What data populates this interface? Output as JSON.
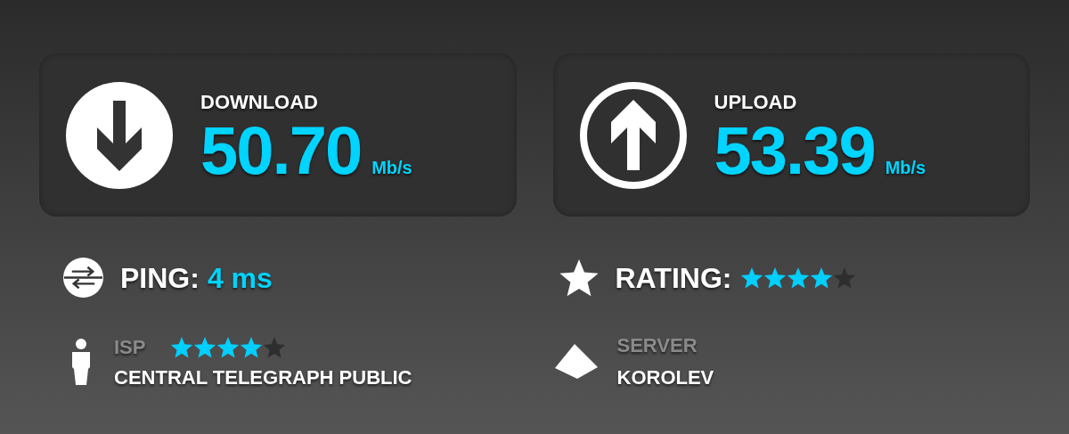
{
  "speeds": [
    {
      "kind": "download",
      "label": "DOWNLOAD",
      "value": "50.70",
      "unit": "Mb/s"
    },
    {
      "kind": "upload",
      "label": "UPLOAD",
      "value": "53.39",
      "unit": "Mb/s"
    }
  ],
  "ping": {
    "label": "PING:",
    "value": "4 ms"
  },
  "rating": {
    "label": "RATING:",
    "stars": 4
  },
  "isp": {
    "label": "ISP",
    "stars": 4,
    "name": "CENTRAL TELEGRAPH PUBLIC"
  },
  "server": {
    "label": "SERVER",
    "name": "KOROLEV"
  }
}
